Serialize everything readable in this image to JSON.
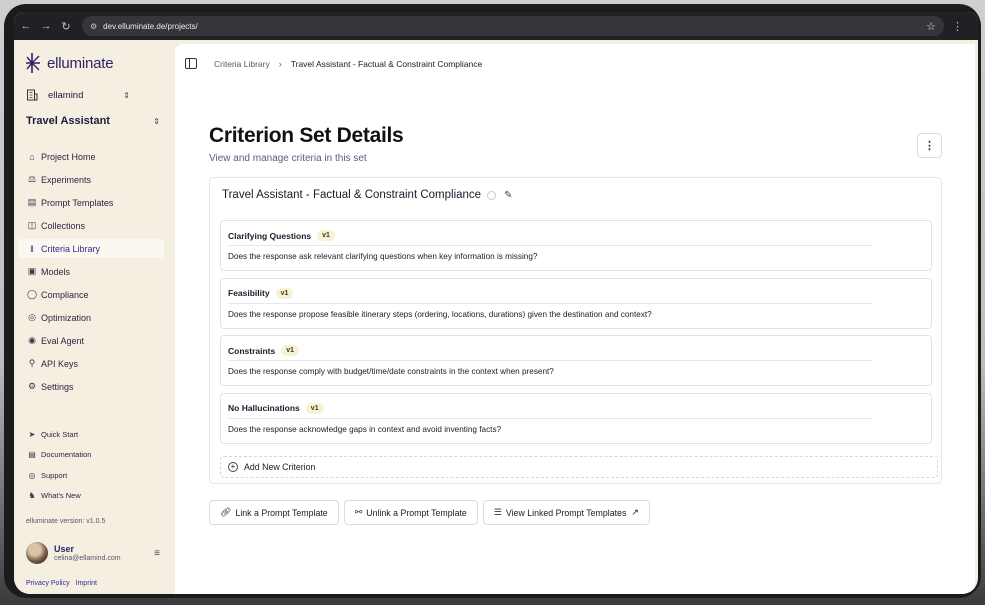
{
  "browser": {
    "url_host": "dev.elluminate.de",
    "url_path": "/projects/",
    "icons": [
      "back-icon",
      "forward-icon",
      "reload-icon",
      "site-settings-icon",
      "bookmark-star-icon",
      "more-vert-icon"
    ]
  },
  "sidebar": {
    "brand": "elluminate",
    "org": "ellamind",
    "project": "Travel Assistant",
    "items": [
      {
        "label": "Project Home",
        "icon": "home-icon",
        "active": false
      },
      {
        "label": "Experiments",
        "icon": "flask-icon",
        "active": false
      },
      {
        "label": "Prompt Templates",
        "icon": "document-icon",
        "active": false
      },
      {
        "label": "Collections",
        "icon": "collection-icon",
        "active": false
      },
      {
        "label": "Criteria Library",
        "icon": "library-icon",
        "active": true
      },
      {
        "label": "Models",
        "icon": "cube-icon",
        "active": false
      },
      {
        "label": "Compliance",
        "icon": "shield-icon",
        "active": false
      },
      {
        "label": "Optimization",
        "icon": "target-icon",
        "active": false
      },
      {
        "label": "Eval Agent",
        "icon": "bot-icon",
        "active": false
      },
      {
        "label": "API Keys",
        "icon": "key-icon",
        "active": false
      },
      {
        "label": "Settings",
        "icon": "gear-icon",
        "active": false
      }
    ],
    "links": [
      {
        "label": "Quick Start",
        "icon": "rocket-icon"
      },
      {
        "label": "Documentation",
        "icon": "book-icon"
      },
      {
        "label": "Support",
        "icon": "lifebuoy-icon"
      },
      {
        "label": "What's New",
        "icon": "bell-icon"
      }
    ],
    "version": "elluminate version: v1.0.5",
    "user": {
      "name": "User",
      "email": "celina@ellamind.com"
    },
    "legal": {
      "privacy": "Privacy Policy",
      "imprint": "Imprint"
    }
  },
  "breadcrumb": {
    "parent": "Criteria Library",
    "current": "Travel Assistant - Factual & Constraint Compliance"
  },
  "page": {
    "title": "Criterion Set Details",
    "subtitle": "View and manage criteria in this set"
  },
  "criterion_set": {
    "name": "Travel Assistant - Factual & Constraint Compliance",
    "criteria": [
      {
        "name": "Clarifying Questions",
        "version": "v1",
        "description": "Does the response ask relevant clarifying questions when key information is missing?"
      },
      {
        "name": "Feasibility",
        "version": "v1",
        "description": "Does the response propose feasible itinerary steps (ordering, locations, durations) given the destination and context?"
      },
      {
        "name": "Constraints",
        "version": "v1",
        "description": "Does the response comply with budget/time/date constraints in the context when present?"
      },
      {
        "name": "No Hallucinations",
        "version": "v1",
        "description": "Does the response acknowledge gaps in context and avoid inventing facts?"
      }
    ],
    "add_label": "Add New Criterion"
  },
  "actions": {
    "link": "Link a Prompt Template",
    "unlink": "Unlink a Prompt Template",
    "view": "View Linked Prompt Templates"
  },
  "colors": {
    "brand": "#2c2462",
    "sidebar_bg": "#f5efe2",
    "active_item": "#332c8c",
    "badge_bg": "#f7f2d6"
  }
}
